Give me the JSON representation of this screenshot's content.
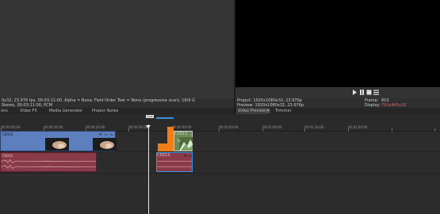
{
  "info_bar": {
    "line1": "0x32, 23.976 fps, 00:03:11:00, Alpha = None, Field Order Text = None (progressive scan), 16/9 G",
    "line2": "Stereo, 00:03:11:00, PCM"
  },
  "left_tabs": [
    "ons",
    "Video FX",
    "Media Generator",
    "Project Notes"
  ],
  "preview_info": {
    "project_label": "Project:",
    "project_value": "1920x1080x32, 23.976p",
    "preview_label": "Preview:",
    "preview_value": "1920x1080x32, 23.976p",
    "frame_label": "Frame:",
    "frame_value": "810",
    "display_label": "Display:",
    "display_value": "791x445x32"
  },
  "right_tabs": {
    "video_preview": "Video Preview",
    "close": "✕",
    "trimmer": "Trimmer"
  },
  "transport_icons": [
    "play-icon",
    "pause-icon",
    "stop-icon",
    "menu-icon"
  ],
  "ruler": {
    "cursor_label": "0:13",
    "labels": [
      "00:00:00:00",
      "00:00:10:00",
      "00:00:20:00",
      "00:00:30:00",
      "00:00:40:00",
      "00:00:50:00",
      "00:01:00:00",
      "00:01:10:00",
      "00:01:20:00"
    ]
  },
  "clips": {
    "video_main": "C0014",
    "video_right": "C0013",
    "audio_main": "C0014",
    "audio_right": "C0013",
    "fx": "fx"
  },
  "colors": {
    "video_clip": "#5d7fbe",
    "audio_clip": "#8a3b4a",
    "highlight": "#ef7e18",
    "selection": "#3d8fe0"
  }
}
